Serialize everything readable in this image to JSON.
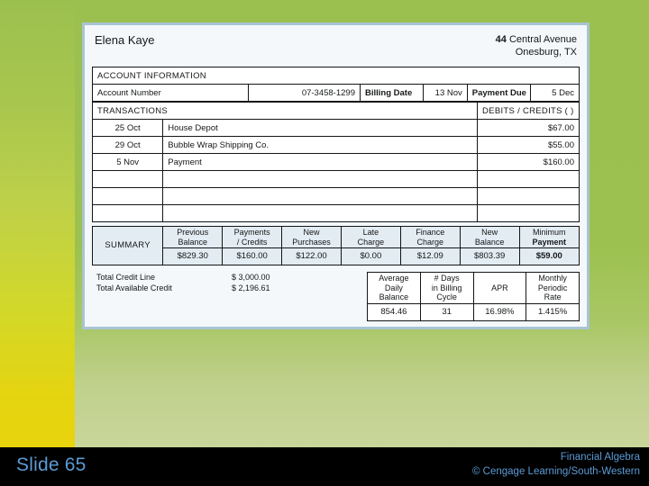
{
  "slide": {
    "number_label": "Slide 65",
    "credit_line_1": "Financial Algebra",
    "credit_line_2": "© Cengage Learning/South-Western"
  },
  "statement": {
    "customer_name": "Elena Kaye",
    "address_number": "44",
    "address_street": "Central Avenue",
    "address_city_state": "Onesburg, TX",
    "account_information_header": "ACCOUNT INFORMATION",
    "account_number_label": "Account Number",
    "account_number_value": "07-3458-1299",
    "billing_date_label": "Billing Date",
    "billing_date_value": "13 Nov",
    "payment_due_label": "Payment Due",
    "payment_due_value": "5 Dec",
    "transactions_header": "TRANSACTIONS",
    "debits_credits_header": "DEBITS / CREDITS (  )",
    "transactions": [
      {
        "date": "25 Oct",
        "description": "House Depot",
        "amount": "$67.00"
      },
      {
        "date": "29 Oct",
        "description": "Bubble Wrap Shipping Co.",
        "amount": "$55.00"
      },
      {
        "date": "5 Nov",
        "description": "Payment",
        "amount": "$160.00"
      },
      {
        "date": "",
        "description": "",
        "amount": ""
      },
      {
        "date": "",
        "description": "",
        "amount": ""
      },
      {
        "date": "",
        "description": "",
        "amount": ""
      }
    ],
    "summary_label": "SUMMARY",
    "summary_columns": [
      {
        "line1": "Previous",
        "line2": "Balance",
        "value": "$829.30"
      },
      {
        "line1": "Payments",
        "line2": "/ Credits",
        "value": "$160.00"
      },
      {
        "line1": "New",
        "line2": "Purchases",
        "value": "$122.00"
      },
      {
        "line1": "Late",
        "line2": "Charge",
        "value": "$0.00"
      },
      {
        "line1": "Finance",
        "line2": "Charge",
        "value": "$12.09"
      },
      {
        "line1": "New",
        "line2": "Balance",
        "value": "$803.39"
      },
      {
        "line1": "Minimum",
        "line2": "Payment",
        "value": "$59.00"
      }
    ],
    "total_credit_line_label": "Total Credit Line",
    "total_credit_line_value": "$ 3,000.00",
    "total_available_credit_label": "Total Available Credit",
    "total_available_credit_value": "$ 2,196.61",
    "apr_columns": [
      {
        "line1": "Average",
        "line2": "Daily",
        "line3": "Balance",
        "value": "854.46"
      },
      {
        "line1": "# Days",
        "line2": "in Billing",
        "line3": "Cycle",
        "value": "31"
      },
      {
        "line1": "APR",
        "line2": "",
        "line3": "",
        "value": "16.98%"
      },
      {
        "line1": "Monthly",
        "line2": "Periodic",
        "line3": "Rate",
        "value": "1.415%"
      }
    ]
  },
  "colors": {
    "band_green": "#9cc04f",
    "band_yellow": "#e8d30c",
    "card_border": "#a8c4d4",
    "summary_fill": "#e2ecf2",
    "footer_text": "#5b9bd5"
  }
}
